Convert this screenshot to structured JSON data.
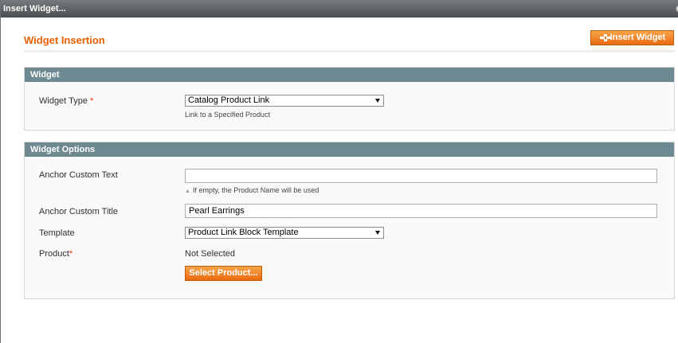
{
  "window": {
    "title": "Insert Widget..."
  },
  "header": {
    "title": "Widget Insertion",
    "insert_button_label": "Insert Widget"
  },
  "widget_section": {
    "title": "Widget",
    "widget_type_label": "Widget Type",
    "required_mark": "*",
    "widget_type_value": "Catalog Product Link",
    "widget_type_note": "Link to a Specified Product"
  },
  "options_section": {
    "title": "Widget Options",
    "anchor_text_label": "Anchor Custom Text",
    "anchor_text_value": "",
    "anchor_text_note": "If empty, the Product Name will be used",
    "anchor_title_label": "Anchor Custom Title",
    "anchor_title_value": "Pearl Earrings",
    "template_label": "Template",
    "template_value": "Product Link Block Template",
    "product_label": "Product",
    "product_required_mark": "*",
    "product_value": "Not Selected",
    "select_product_label": "Select Product..."
  },
  "colors": {
    "accent": "#eb5e00",
    "section_header": "#6f8992",
    "button": "#eb6a10"
  }
}
